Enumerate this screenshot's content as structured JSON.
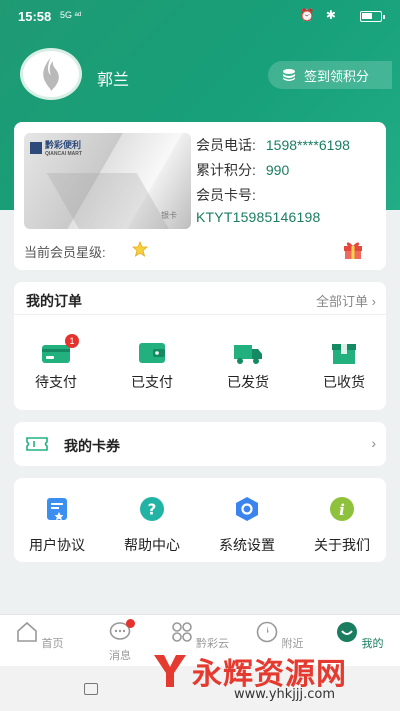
{
  "status": {
    "time": "15:58",
    "network": "5G ᵃᵈ",
    "icons": "⏰ ✱"
  },
  "user": {
    "name": "郭兰"
  },
  "signin": {
    "label": "签到领积分"
  },
  "member": {
    "card_brand": "黔彩便利",
    "card_brand_en": "QIANCAI MART",
    "card_type": "银卡",
    "phone_label": "会员电话:",
    "phone": "1598****6198",
    "points_label": "累计积分:",
    "points": "990",
    "card_no_label": "会员卡号:",
    "card_no": "KTYT15985146198",
    "star_label": "当前会员星级:"
  },
  "orders": {
    "title": "我的订单",
    "all_label": "全部订单",
    "items": [
      {
        "label": "待支付",
        "badge": "1",
        "icon": "wallet-card-icon"
      },
      {
        "label": "已支付",
        "icon": "wallet-icon"
      },
      {
        "label": "已发货",
        "icon": "truck-icon"
      },
      {
        "label": "已收货",
        "icon": "box-icon"
      }
    ]
  },
  "coupons": {
    "label": "我的卡券",
    "icon": "ticket-icon"
  },
  "tools": {
    "items": [
      {
        "label": "用户协议",
        "icon": "document-icon"
      },
      {
        "label": "帮助中心",
        "icon": "help-icon"
      },
      {
        "label": "系统设置",
        "icon": "settings-icon"
      },
      {
        "label": "关于我们",
        "icon": "info-icon"
      }
    ]
  },
  "tabs": [
    {
      "label": "首页",
      "icon": "home-icon"
    },
    {
      "label": "消息",
      "icon": "message-icon"
    },
    {
      "label": "黔彩云",
      "icon": "apps-icon"
    },
    {
      "label": "附近",
      "icon": "compass-icon"
    },
    {
      "label": "我的",
      "icon": "profile-icon"
    }
  ],
  "watermark": {
    "text": "永辉资源网",
    "url": "www.yhkjjj.com"
  },
  "colors": {
    "primary": "#1f9a73",
    "accent_text": "#1a7d60",
    "badge": "#e5322d"
  }
}
